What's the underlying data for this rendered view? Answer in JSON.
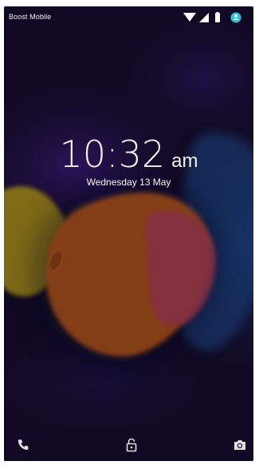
{
  "status_bar": {
    "carrier": "Boost Mobile",
    "icons": [
      "wifi-icon",
      "signal-icon",
      "battery-icon",
      "account-icon"
    ],
    "account_color": "#26c6da"
  },
  "lockscreen": {
    "time": "10:32",
    "ampm": "am",
    "date": "Wednesday 13 May"
  },
  "bottom_bar": {
    "left": "phone-icon",
    "center": "lock-icon",
    "right": "camera-icon"
  },
  "colors": {
    "background": "#150d2c",
    "yellow_blob": "#a48a1a",
    "orange_blob": "#a8501c",
    "pink_blob": "#a03a55",
    "blue_blob": "#1d3d78"
  }
}
